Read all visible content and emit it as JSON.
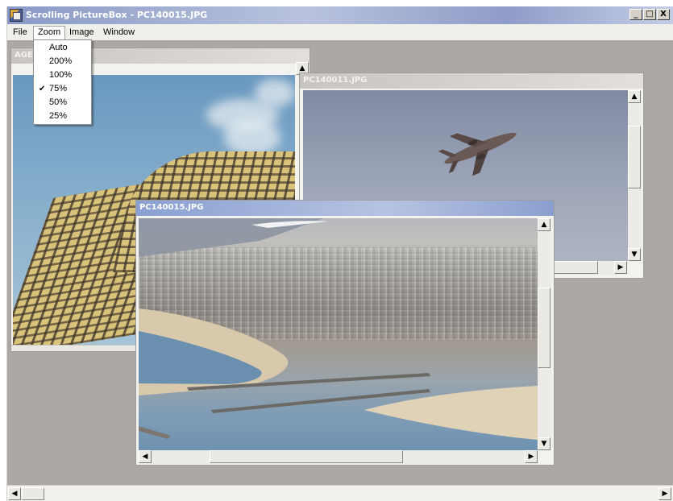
{
  "window": {
    "title": "Scrolling PictureBox - PC140015.JPG",
    "controls": [
      "_",
      "□",
      "X"
    ]
  },
  "menubar": {
    "items": [
      "File",
      "Zoom",
      "Image",
      "Window"
    ]
  },
  "zoom_menu": {
    "items": [
      "Auto",
      "200%",
      "100%",
      "75%",
      "50%",
      "25%"
    ],
    "checked": "75%",
    "check_mark": "✔"
  },
  "children": {
    "building": {
      "title": "AGE0"
    },
    "airplane": {
      "title": "PC140011.JPG"
    },
    "coast": {
      "title": "PC140015.JPG"
    }
  },
  "scroll_arrows": {
    "up": "▲",
    "down": "▼",
    "left": "◀",
    "right": "▶"
  }
}
